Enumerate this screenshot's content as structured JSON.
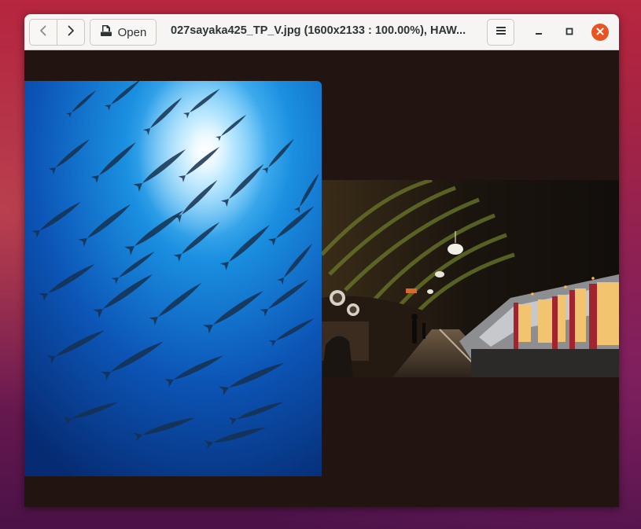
{
  "window": {
    "title": "027sayaka425_TP_V.jpg (1600x2133 : 100.00%), HAW..."
  },
  "toolbar": {
    "open_label": "Open",
    "back_icon": "chevron-left-icon",
    "forward_icon": "chevron-right-icon",
    "open_icon": "document-open-icon",
    "menu_icon": "hamburger-menu-icon"
  },
  "window_controls": {
    "minimize_icon": "minimize-icon",
    "maximize_icon": "maximize-icon",
    "close_icon": "close-icon"
  },
  "colors": {
    "accent": "#e95420",
    "viewer_background": "#221410",
    "headerbar": "#f6f5f4"
  }
}
